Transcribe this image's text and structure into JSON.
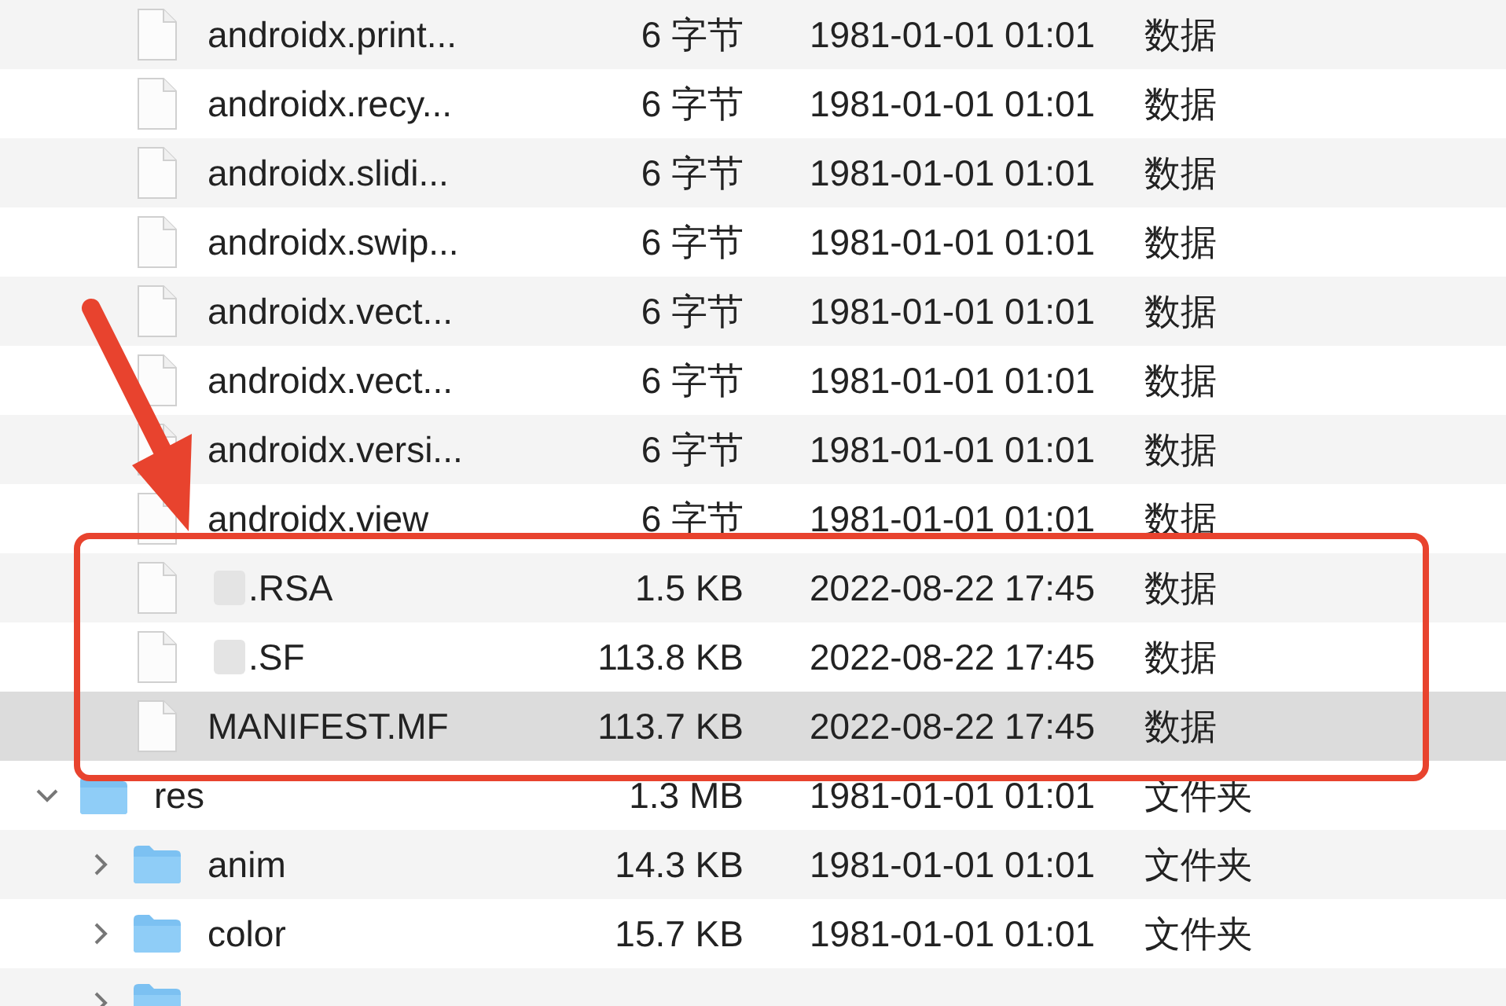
{
  "files_above": [
    {
      "name": "androidx.print...",
      "size": "6 字节",
      "date": "1981-01-01 01:01",
      "kind": "数据",
      "selected": false
    },
    {
      "name": "androidx.recy...",
      "size": "6 字节",
      "date": "1981-01-01 01:01",
      "kind": "数据",
      "selected": false
    },
    {
      "name": "androidx.slidi...",
      "size": "6 字节",
      "date": "1981-01-01 01:01",
      "kind": "数据",
      "selected": false
    },
    {
      "name": "androidx.swip...",
      "size": "6 字节",
      "date": "1981-01-01 01:01",
      "kind": "数据",
      "selected": false
    },
    {
      "name": "androidx.vect...",
      "size": "6 字节",
      "date": "1981-01-01 01:01",
      "kind": "数据",
      "selected": false
    },
    {
      "name": "androidx.vect...",
      "size": "6 字节",
      "date": "1981-01-01 01:01",
      "kind": "数据",
      "selected": false
    },
    {
      "name": "androidx.versi...",
      "size": "6 字节",
      "date": "1981-01-01 01:01",
      "kind": "数据",
      "selected": false
    },
    {
      "name": "androidx.view",
      "size": "6 字节",
      "date": "1981-01-01 01:01",
      "kind": "数据",
      "selected": false
    },
    {
      "name": ".RSA",
      "size": "1.5 KB",
      "date": "2022-08-22 17:45",
      "kind": "数据",
      "selected": false,
      "redacted": true
    },
    {
      "name": ".SF",
      "size": "113.8 KB",
      "date": "2022-08-22 17:45",
      "kind": "数据",
      "selected": false,
      "redacted": true
    },
    {
      "name": "MANIFEST.MF",
      "size": "113.7 KB",
      "date": "2022-08-22 17:45",
      "kind": "数据",
      "selected": true,
      "redacted": false
    }
  ],
  "tree": [
    {
      "name": "res",
      "size": "1.3 MB",
      "date": "1981-01-01 01:01",
      "kind": "文件夹",
      "selected": false,
      "expanded": true,
      "children": [
        {
          "name": "anim",
          "size": "14.3 KB",
          "date": "1981-01-01 01:01",
          "kind": "文件夹",
          "selected": false,
          "expanded": false
        },
        {
          "name": "color",
          "size": "15.7 KB",
          "date": "1981-01-01 01:01",
          "kind": "文件夹",
          "selected": false,
          "expanded": false
        },
        {
          "selected": false,
          "expanded": false
        }
      ]
    }
  ],
  "pointer_arrow": true,
  "highlight_box": true
}
